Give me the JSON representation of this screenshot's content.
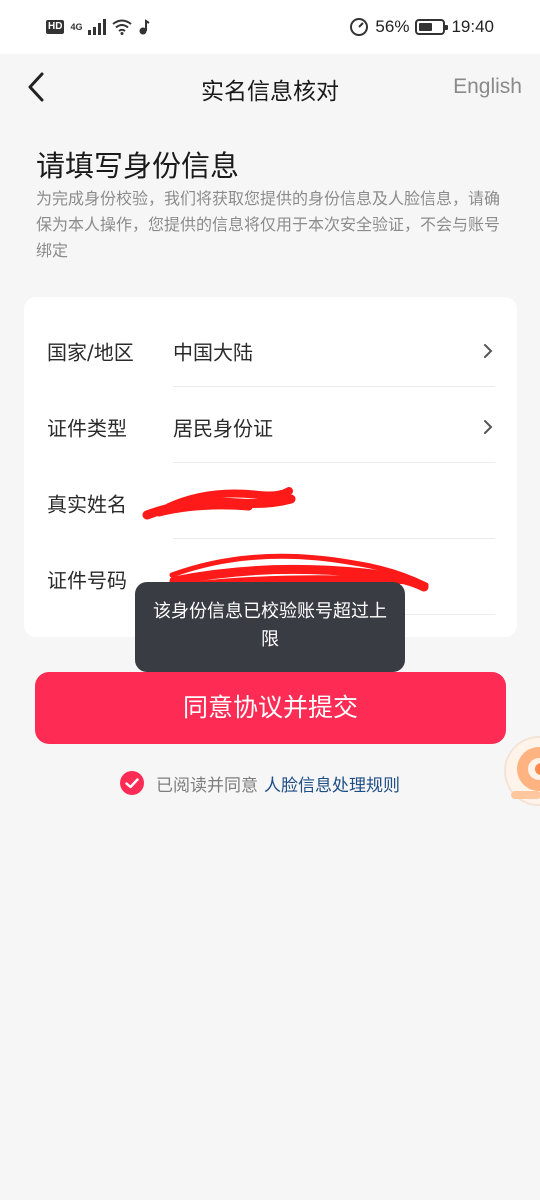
{
  "status_bar": {
    "hd": "HD",
    "network": "4G",
    "battery_percent": "56%",
    "battery_level": 0.56,
    "time": "19:40"
  },
  "nav": {
    "title": "实名信息核对",
    "language_toggle": "English"
  },
  "header": {
    "title": "请填写身份信息",
    "description": "为完成身份校验，我们将获取您提供的身份信息及人脸信息，请确保为本人操作，您提供的信息将仅用于本次安全验证，不会与账号绑定"
  },
  "form": {
    "rows": [
      {
        "label": "国家/地区",
        "value": "中国大陆",
        "has_chevron": true
      },
      {
        "label": "证件类型",
        "value": "居民身份证",
        "has_chevron": true
      },
      {
        "label": "真实姓名",
        "value": "",
        "has_chevron": false
      },
      {
        "label": "证件号码",
        "value": "",
        "has_chevron": false
      }
    ]
  },
  "toast": {
    "message": "该身份信息已校验账号超过上限"
  },
  "submit": {
    "label": "同意协议并提交"
  },
  "agreement": {
    "checked": true,
    "text": "已阅读并同意",
    "link": "人脸信息处理规则"
  },
  "colors": {
    "accent": "#fe2c55",
    "link": "#1e4e86",
    "toast_bg": "#3a3c44",
    "redaction": "#ff1a1a"
  },
  "icons": {
    "back": "back-arrow-icon",
    "chevron": "chevron-right-icon",
    "check": "check-circle-icon"
  }
}
